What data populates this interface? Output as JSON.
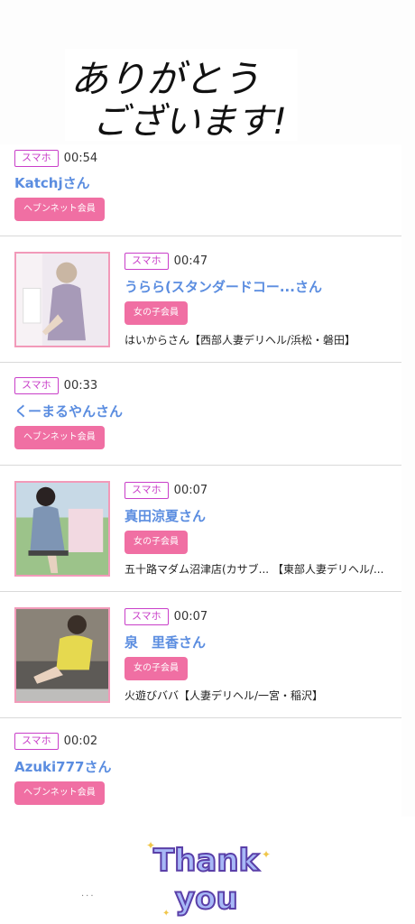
{
  "header": {
    "thank_you_line1": "ありがとう",
    "thank_you_line2": "ございます!"
  },
  "items": [
    {
      "device": "スマホ",
      "time": "00:54",
      "name": "Katchjさん",
      "member": "ヘブンネット会員",
      "has_image": false,
      "shop": ""
    },
    {
      "device": "スマホ",
      "time": "00:47",
      "name": "うらら(スタンダードコー...さん",
      "member": "女の子会員",
      "has_image": true,
      "shop": "はいからさん【西部人妻デリヘル/浜松・磐田】"
    },
    {
      "device": "スマホ",
      "time": "00:33",
      "name": "くーまるやんさん",
      "member": "ヘブンネット会員",
      "has_image": false,
      "shop": ""
    },
    {
      "device": "スマホ",
      "time": "00:07",
      "name": "真田涼夏さん",
      "member": "女の子会員",
      "has_image": true,
      "shop": "五十路マダム沼津店(カサブ... 【東部人妻デリヘル/..."
    },
    {
      "device": "スマホ",
      "time": "00:07",
      "name": "泉　里香さん",
      "member": "女の子会員",
      "has_image": true,
      "shop": "火遊びババ【人妻デリヘル/一宮・稲沢】"
    },
    {
      "device": "スマホ",
      "time": "00:02",
      "name": "Azuki777さん",
      "member": "ヘブンネット会員",
      "has_image": false,
      "shop": ""
    }
  ],
  "footer": {
    "thank_line1": "Thank",
    "thank_line2": "you",
    "dots": "..."
  },
  "colors": {
    "accent_pink": "#f06fa3",
    "badge_purple": "#c93fc9",
    "name_blue": "#5b8de0"
  }
}
